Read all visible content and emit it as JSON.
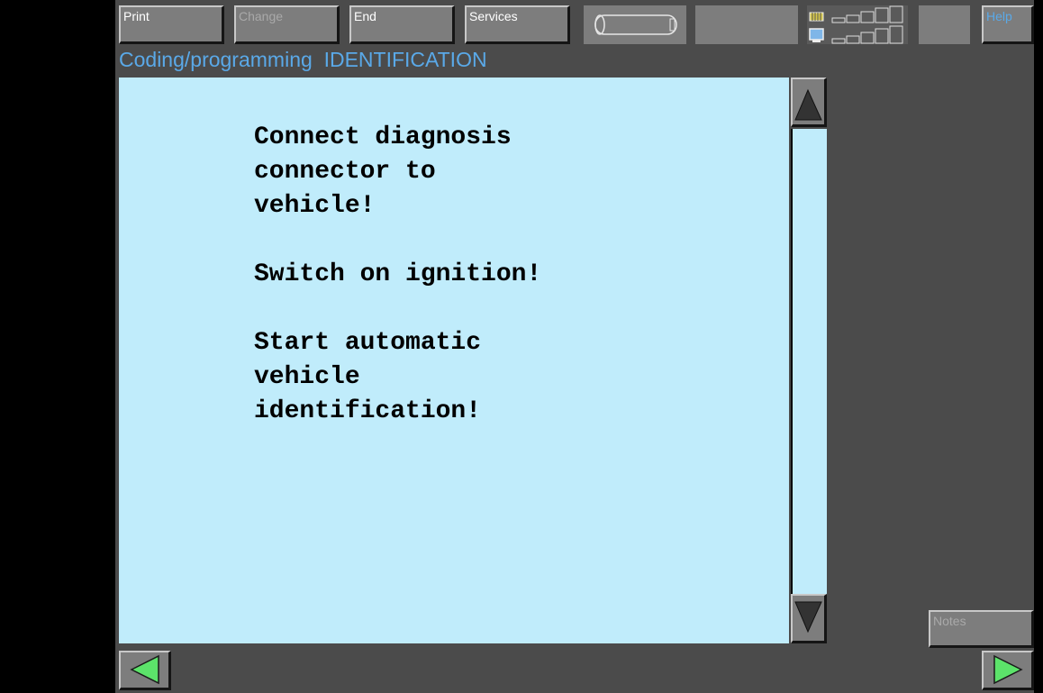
{
  "toolbar": {
    "print_label": "Print",
    "change_label": "Change",
    "end_label": "End",
    "services_label": "Services",
    "help_label": "Help"
  },
  "breadcrumb": {
    "section": "Coding/programming",
    "page": "IDENTIFICATION"
  },
  "content": {
    "message": "Connect diagnosis\nconnector to\nvehicle!\n\nSwitch on ignition!\n\nStart automatic\nvehicle\nidentification!"
  },
  "side": {
    "notes_label": "Notes"
  },
  "icons": {
    "status_indicator": "cylinder-icon",
    "signal_top": "chip-signal-icon",
    "signal_bottom": "monitor-signal-icon",
    "scroll_up": "triangle-up-icon",
    "scroll_down": "triangle-down-icon",
    "back": "arrow-left-icon",
    "forward": "arrow-right-icon"
  },
  "colors": {
    "background": "#4b4b4b",
    "content_background": "#c0ecfb",
    "title_color": "#5aa9e8",
    "nav_arrow": "#5ce36a"
  }
}
